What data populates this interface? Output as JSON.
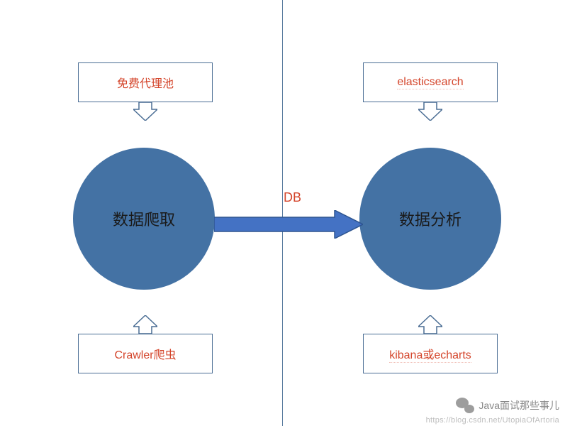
{
  "boxes": {
    "topLeft": "免费代理池",
    "topRight": "elasticsearch",
    "bottomLeft": "Crawler爬虫",
    "bottomRight": "kibana或echarts"
  },
  "circles": {
    "left": "数据爬取",
    "right": "数据分析"
  },
  "arrowLabel": "DB",
  "watermark": {
    "text": "Java面试那些事儿",
    "url": "https://blog.csdn.net/UtopiaOfArtoria"
  },
  "colors": {
    "circleFill": "#4472a4",
    "boxBorder": "#4a6d94",
    "accentText": "#d4452b",
    "arrowFill": "#4472c4",
    "arrowStroke": "#2e5590"
  }
}
